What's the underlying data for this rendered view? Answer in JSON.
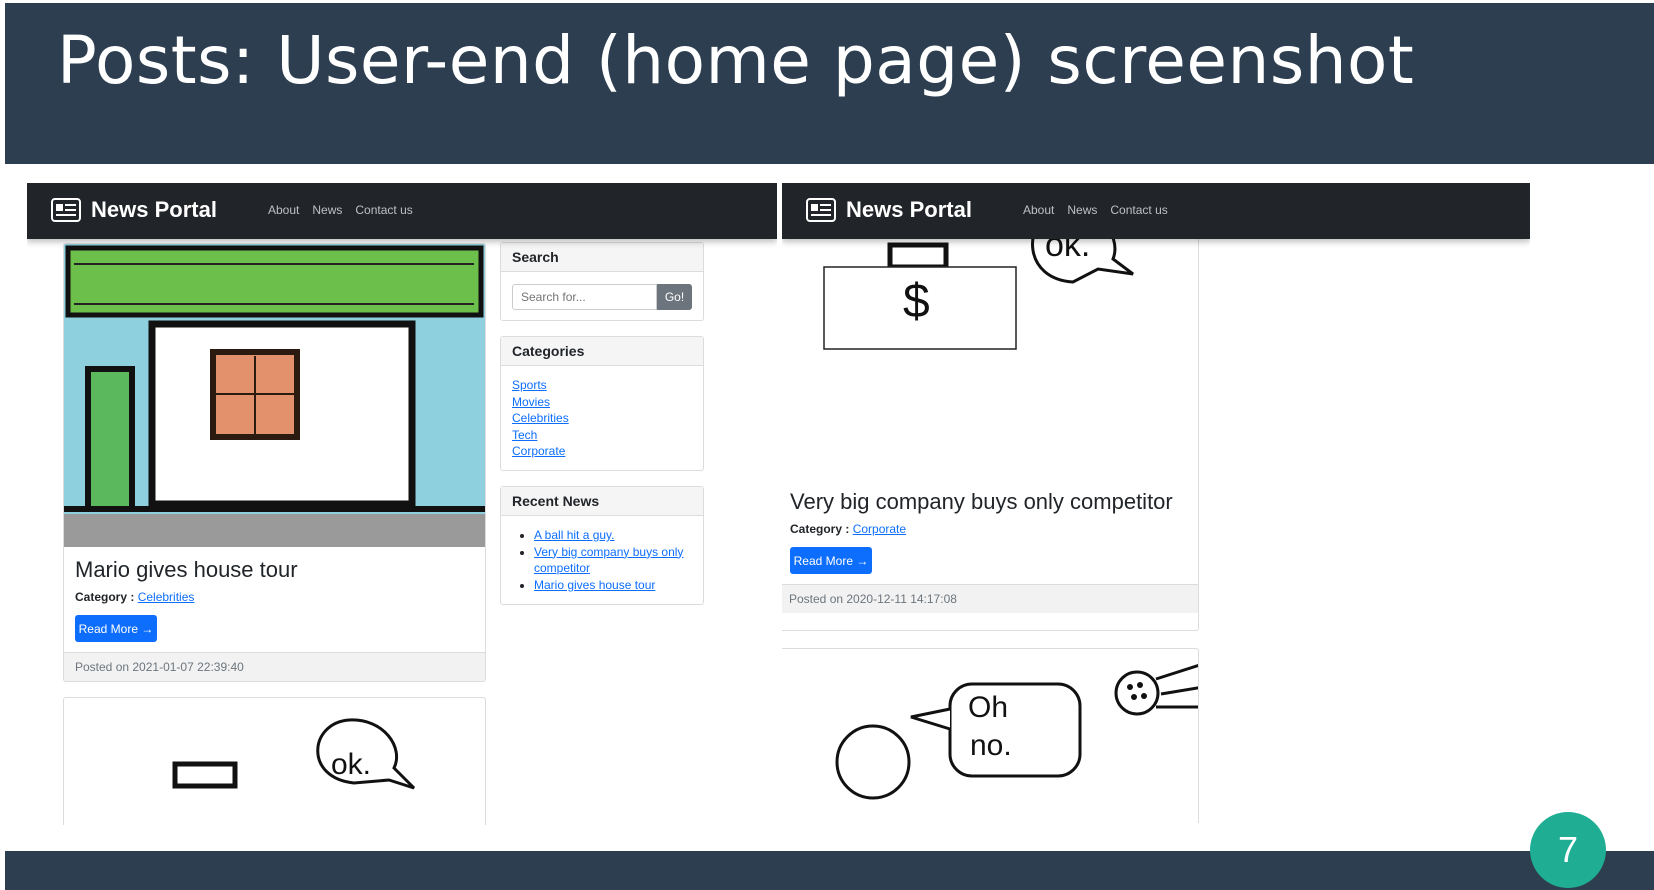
{
  "slide": {
    "title": "Posts: User-end (home page) screenshot",
    "page_number": "7",
    "colors": {
      "header": "#2d3e50",
      "badge": "#1fae93"
    }
  },
  "left_screenshot": {
    "brand": "News Portal",
    "nav": [
      "About",
      "News",
      "Contact us"
    ],
    "post": {
      "title": "Mario gives house tour",
      "category_label": "Category :",
      "category": "Celebrities",
      "button": "Read More →",
      "posted": "Posted on 2021-01-07 22:39:40"
    },
    "sidebar": {
      "search": {
        "title": "Search",
        "placeholder": "Search for...",
        "button": "Go!"
      },
      "categories": {
        "title": "Categories",
        "items": [
          "Sports",
          "Movies",
          "Celebrities",
          "Tech",
          "Corporate"
        ]
      },
      "recent": {
        "title": "Recent News",
        "items": [
          "A ball hit a guy.",
          "Very big company buys only competitor",
          "Mario gives house tour"
        ]
      }
    }
  },
  "right_screenshot": {
    "brand": "News Portal",
    "nav": [
      "About",
      "News",
      "Contact us"
    ],
    "post": {
      "title": "Very big company buys only competitor",
      "category_label": "Category :",
      "category": "Corporate",
      "button": "Read More →",
      "posted": "Posted on 2020-12-11 14:17:08"
    },
    "next_image_text": {
      "bubble_line1": "Oh",
      "bubble_line2": "no."
    },
    "image_text": {
      "bubble": "ok.",
      "symbol": "$"
    }
  }
}
